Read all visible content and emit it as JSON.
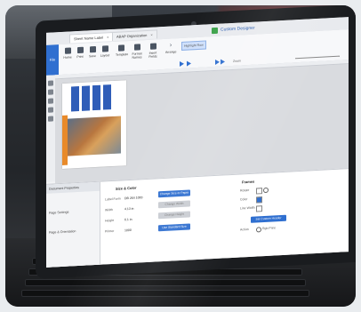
{
  "titlebar": {
    "tabs": [
      {
        "label": "Sheet Name Label"
      },
      {
        "label": "ABAP Organization"
      }
    ],
    "app_title": "Custom Designer"
  },
  "ribbon": {
    "file_label": "File",
    "buttons": [
      {
        "label": "Home"
      },
      {
        "label": "Print"
      },
      {
        "label": "Save"
      },
      {
        "label": "Layout"
      },
      {
        "label": "Template"
      },
      {
        "label": "Format Names"
      },
      {
        "label": "Insert Fields"
      }
    ],
    "arrange_label": "Arrange",
    "zoom_label": "Zoom",
    "highlight_label": "Highlight Row"
  },
  "properties": {
    "sidebar_title": "Document Properties",
    "sidebar_items": [
      {
        "label": "Page Settings"
      },
      {
        "label": "Page & Orientation"
      }
    ],
    "section_title": "Size & Color",
    "rows": [
      {
        "label": "Label Form",
        "value": "DB 264 1000"
      },
      {
        "label": "Width",
        "value": "4.13 in"
      },
      {
        "label": "Height",
        "value": "6.1 in"
      },
      {
        "label": "Printer",
        "value": "1000"
      }
    ],
    "buttons": [
      {
        "label": "Change Size or Paper",
        "disabled": false
      },
      {
        "label": "Change Width",
        "disabled": true
      },
      {
        "label": "Change Height",
        "disabled": true
      },
      {
        "label": "Use Standard Size",
        "disabled": false
      }
    ],
    "right_section_title": "Frames",
    "right_rows": [
      {
        "label": "Rotate"
      },
      {
        "label": "Color"
      },
      {
        "label": "Line Width"
      },
      {
        "label": "Action"
      }
    ],
    "right_button": "Set Custom Header",
    "radio_label": "Rgb Print"
  }
}
